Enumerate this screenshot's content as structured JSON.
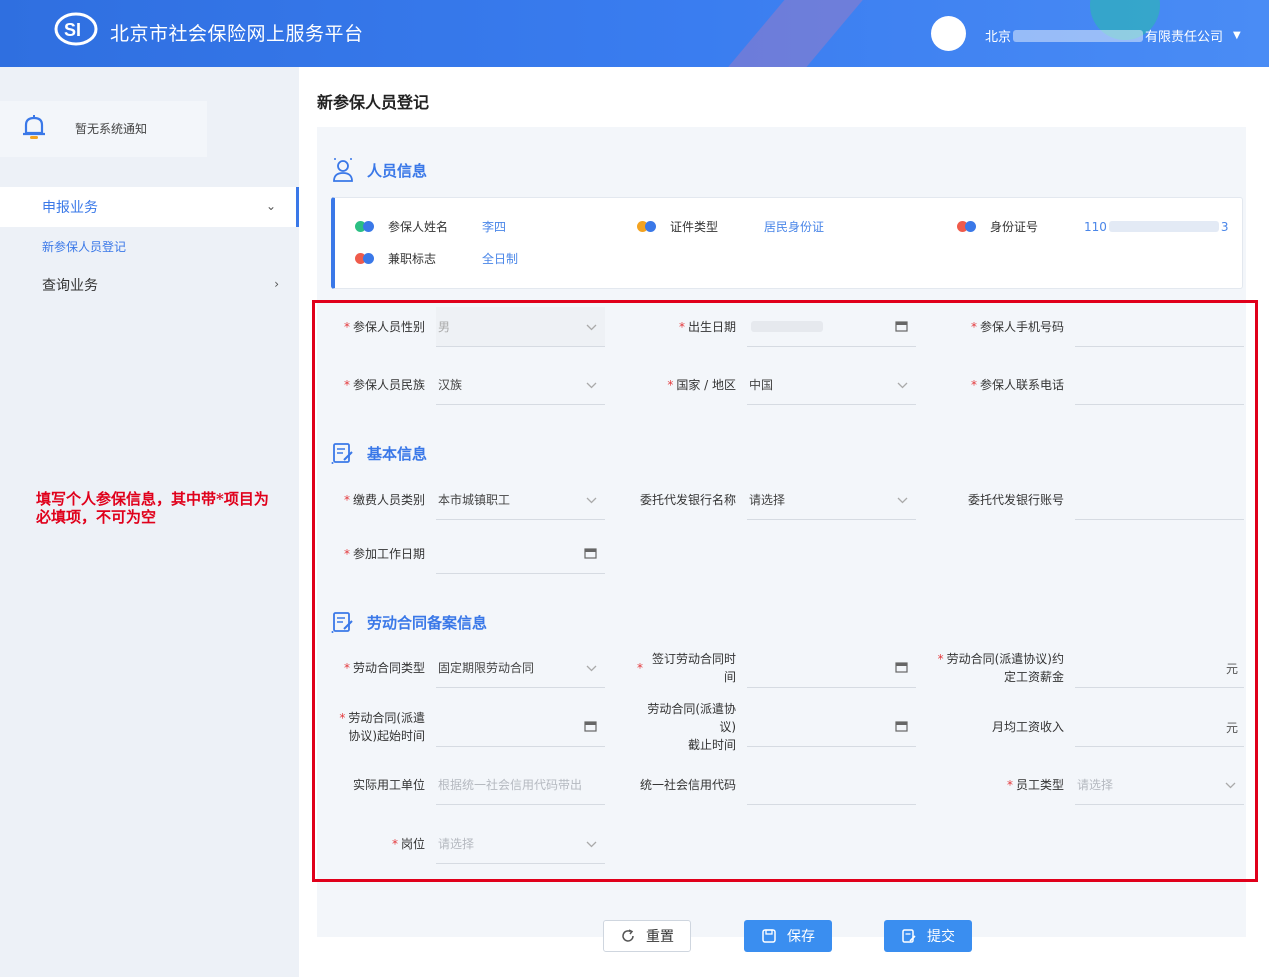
{
  "header": {
    "title": "北京市社会保险网上服务平台",
    "company_prefix": "北京",
    "company_suffix": "有限责任公司"
  },
  "sidebar": {
    "notice": "暂无系统通知",
    "items": [
      {
        "label": "申报业务"
      },
      {
        "label": "新参保人员登记"
      },
      {
        "label": "查询业务"
      }
    ]
  },
  "main": {
    "page_title": "新参保人员登记",
    "sections": {
      "person": "人员信息",
      "basic": "基本信息",
      "contract": "劳动合同备案信息"
    },
    "person_info": {
      "name_label": "参保人姓名",
      "name_value": "李四",
      "idtype_label": "证件类型",
      "idtype_value": "居民身份证",
      "idno_label": "身份证号",
      "idno_prefix": "110",
      "idno_suffix": "3",
      "parttime_label": "兼职标志",
      "parttime_value": "全日制"
    },
    "form": {
      "gender": {
        "label": "参保人员性别",
        "value": "男"
      },
      "birth": {
        "label": "出生日期"
      },
      "mobile": {
        "label": "参保人手机号码"
      },
      "ethnic": {
        "label": "参保人员民族",
        "value": "汉族"
      },
      "country": {
        "label": "国家 / 地区",
        "value": "中国"
      },
      "phone": {
        "label": "参保人联系电话"
      },
      "paytype": {
        "label": "缴费人员类别",
        "value": "本市城镇职工"
      },
      "bank": {
        "label": "委托代发银行名称",
        "placeholder": "请选择"
      },
      "account": {
        "label": "委托代发银行账号"
      },
      "workdate": {
        "label": "参加工作日期"
      },
      "contract_type": {
        "label": "劳动合同类型",
        "value": "固定期限劳动合同"
      },
      "sign_time": {
        "label": "签订劳动合同时间"
      },
      "salary": {
        "label_1": "劳动合同(派遣协议)约",
        "label_2": "定工资薪金",
        "unit": "元"
      },
      "start_time": {
        "label_1": "劳动合同(派遣",
        "label_2": "协议)起始时间"
      },
      "end_time": {
        "label_1": "劳动合同(派遣协议)",
        "label_2": "截止时间"
      },
      "monthly": {
        "label": "月均工资收入",
        "unit": "元"
      },
      "actual_unit": {
        "label": "实际用工单位",
        "placeholder": "根据统一社会信用代码带出"
      },
      "credit_code": {
        "label": "统一社会信用代码"
      },
      "emp_type": {
        "label": "员工类型",
        "placeholder": "请选择"
      },
      "post": {
        "label": "岗位",
        "placeholder": "请选择"
      }
    },
    "buttons": {
      "reset": "重置",
      "save": "保存",
      "submit": "提交"
    }
  },
  "annotation": "填写个人参保信息，其中带*项目为必填项，不可为空"
}
